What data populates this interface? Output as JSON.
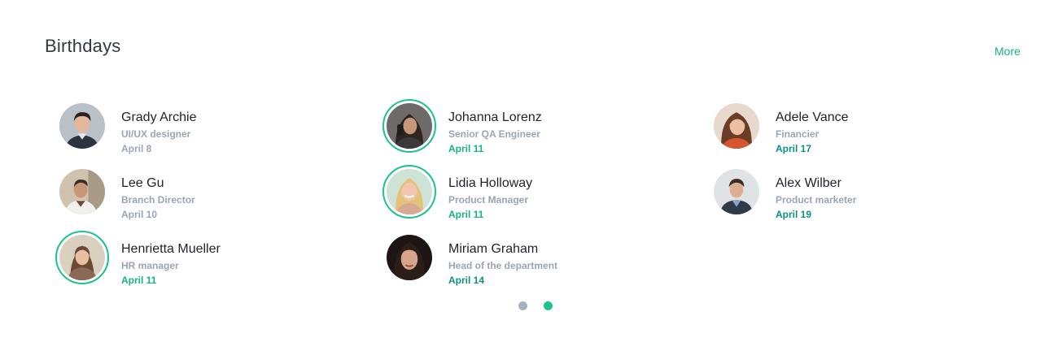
{
  "widget": {
    "title": "Birthdays",
    "more_label": "More"
  },
  "columns": [
    {
      "people": [
        {
          "name": "Grady Archie",
          "role": "UI/UX designer",
          "date": "April 8",
          "status": "past"
        },
        {
          "name": "Lee Gu",
          "role": "Branch Director",
          "date": "April 10",
          "status": "past"
        },
        {
          "name": "Henrietta Mueller",
          "role": "HR manager",
          "date": "April 11",
          "status": "today"
        }
      ]
    },
    {
      "people": [
        {
          "name": "Johanna Lorenz",
          "role": "Senior QA Engineer",
          "date": "April 11",
          "status": "today"
        },
        {
          "name": "Lidia Holloway",
          "role": "Product Manager",
          "date": "April 11",
          "status": "today"
        },
        {
          "name": "Miriam Graham",
          "role": "Head of the department",
          "date": "April 14",
          "status": "soon"
        }
      ]
    },
    {
      "people": [
        {
          "name": "Adele Vance",
          "role": "Financier",
          "date": "April 17",
          "status": "soon"
        },
        {
          "name": "Alex Wilber",
          "role": "Product marketer",
          "date": "April 19",
          "status": "soon"
        }
      ]
    }
  ],
  "pager": {
    "pages": 2,
    "active": 2
  },
  "colors": {
    "accent": "#1cc38a",
    "today_date": "#16b47a",
    "soon_date": "#0f8f86",
    "muted": "#9aa5b5"
  }
}
